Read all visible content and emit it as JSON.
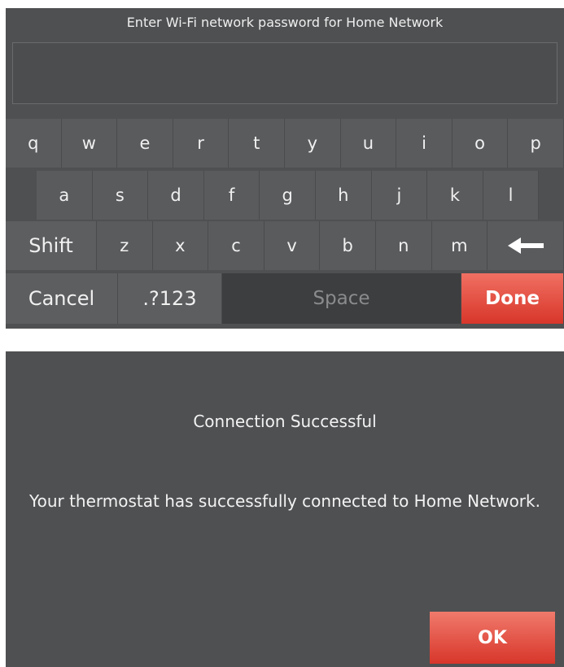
{
  "keyboard_screen": {
    "title": "Enter Wi-Fi network password for Home Network",
    "password_value": "",
    "row1": [
      "q",
      "w",
      "e",
      "r",
      "t",
      "y",
      "u",
      "i",
      "o",
      "p"
    ],
    "row2": [
      "a",
      "s",
      "d",
      "f",
      "g",
      "h",
      "j",
      "k",
      "l"
    ],
    "row3": {
      "shift": "Shift",
      "letters": [
        "z",
        "x",
        "c",
        "v",
        "b",
        "n",
        "m"
      ],
      "backspace_icon": "left-arrow-icon"
    },
    "row4": {
      "cancel": "Cancel",
      "symbols": ".?123",
      "space": "Space",
      "done": "Done"
    }
  },
  "message_screen": {
    "title": "Connection Successful",
    "body": "Your thermostat has successfully connected to Home Network.",
    "ok": "OK"
  },
  "colors": {
    "screen_bg": "#4f5052",
    "accent_red": "#e0463a"
  }
}
